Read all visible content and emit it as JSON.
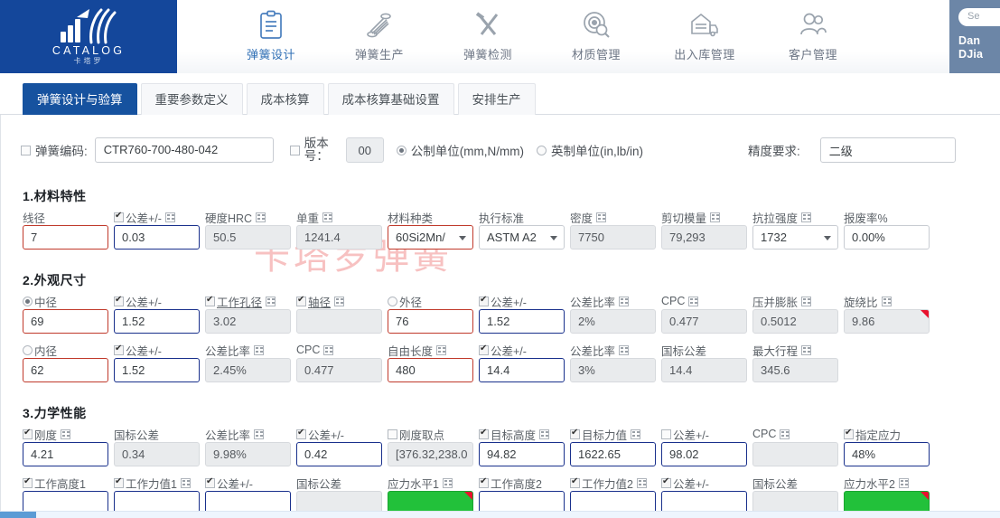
{
  "brand": {
    "name": "CATALOG",
    "sub": "卡塔罗"
  },
  "topnav": [
    {
      "label": "弹簧设计",
      "icon": "clipboard-icon",
      "active": true
    },
    {
      "label": "弹簧生产",
      "icon": "spring-icon",
      "active": false
    },
    {
      "label": "弹簧检测",
      "icon": "tools-icon",
      "active": false
    },
    {
      "label": "材质管理",
      "icon": "target-search-icon",
      "active": false
    },
    {
      "label": "出入库管理",
      "icon": "warehouse-truck-icon",
      "active": false
    },
    {
      "label": "客户管理",
      "icon": "users-icon",
      "active": false
    }
  ],
  "user": {
    "search_placeholder": "Se",
    "name_line1": "Dan",
    "name_line2": "DJia"
  },
  "tabs": [
    {
      "label": "弹簧设计与验算",
      "active": true
    },
    {
      "label": "重要参数定义",
      "active": false
    },
    {
      "label": "成本核算",
      "active": false
    },
    {
      "label": "成本核算基础设置",
      "active": false
    },
    {
      "label": "安排生产",
      "active": false
    }
  ],
  "watermark": "卡塔罗弹簧",
  "header": {
    "code_label": "弹簧编码:",
    "code_value": "CTR760-700-480-042",
    "version_label": "版本号：",
    "version_value": "00",
    "unit_metric": "公制单位(mm,N/mm)",
    "unit_imperial": "英制单位(in,lb/in)",
    "precision_label": "精度要求:",
    "precision_value": "二级"
  },
  "sections": [
    {
      "title": "1.材料特性",
      "rows": [
        [
          {
            "label": "线径",
            "value": "7",
            "style": "red",
            "check": "none"
          },
          {
            "label": "公差+/-",
            "value": "0.03",
            "style": "blue",
            "check": "checked",
            "calc": true
          },
          {
            "label": "硬度HRC",
            "value": "50.5",
            "style": "ro",
            "check": "none",
            "calc": true
          },
          {
            "label": "单重",
            "value": "1241.4",
            "style": "ro",
            "check": "none",
            "calc": true
          },
          {
            "label": "材料种类",
            "value": "60Si2Mn/",
            "style": "red",
            "check": "none",
            "select": true
          },
          {
            "label": "执行标准",
            "value": "ASTM A2",
            "style": "plain",
            "check": "none",
            "select": true
          },
          {
            "label": "密度",
            "value": "7750",
            "style": "ro",
            "check": "none",
            "calc": true
          },
          {
            "label": "剪切模量",
            "value": "79,293",
            "style": "ro",
            "check": "none",
            "calc": true
          },
          {
            "label": "抗拉强度",
            "value": "1732",
            "style": "plain",
            "check": "none",
            "calc": true,
            "select": true
          },
          {
            "label": "报废率%",
            "value": "0.00%",
            "style": "plain",
            "check": "none"
          }
        ]
      ]
    },
    {
      "title": "2.外观尺寸",
      "rows": [
        [
          {
            "label": "中径",
            "value": "69",
            "style": "red",
            "check": "radio-sel"
          },
          {
            "label": "公差+/-",
            "value": "1.52",
            "style": "blue",
            "check": "checked"
          },
          {
            "label": "工作孔径",
            "value": "3.02",
            "style": "ro",
            "check": "checked",
            "calc": true,
            "underline": true
          },
          {
            "label": "轴径",
            "value": "",
            "style": "ro",
            "check": "checked",
            "calc": true,
            "underline": true
          },
          {
            "label": "外径",
            "value": "76",
            "style": "red",
            "check": "radio"
          },
          {
            "label": "公差+/-",
            "value": "1.52",
            "style": "blue",
            "check": "checked"
          },
          {
            "label": "公差比率",
            "value": "2%",
            "style": "ro",
            "check": "none",
            "calc": true
          },
          {
            "label": "CPC",
            "value": "0.477",
            "style": "ro",
            "check": "none",
            "calc": true
          },
          {
            "label": "压并膨胀",
            "value": "0.5012",
            "style": "ro",
            "check": "none",
            "calc": true
          },
          {
            "label": "旋绕比",
            "value": "9.86",
            "style": "ro",
            "check": "none",
            "calc": true,
            "corner": true
          }
        ],
        [
          {
            "label": "内径",
            "value": "62",
            "style": "red",
            "check": "radio"
          },
          {
            "label": "公差+/-",
            "value": "1.52",
            "style": "blue",
            "check": "checked"
          },
          {
            "label": "公差比率",
            "value": "2.45%",
            "style": "ro",
            "check": "none",
            "calc": true
          },
          {
            "label": "CPC",
            "value": "0.477",
            "style": "ro",
            "check": "none",
            "calc": true
          },
          {
            "label": "自由长度",
            "value": "480",
            "style": "red",
            "check": "none",
            "calc": true
          },
          {
            "label": "公差+/-",
            "value": "14.4",
            "style": "blue",
            "check": "checked"
          },
          {
            "label": "公差比率",
            "value": "3%",
            "style": "ro",
            "check": "none",
            "calc": true
          },
          {
            "label": "国标公差",
            "value": "14.4",
            "style": "ro",
            "check": "none"
          },
          {
            "label": "最大行程",
            "value": "345.6",
            "style": "ro",
            "check": "none",
            "calc": true
          }
        ]
      ]
    },
    {
      "title": "3.力学性能",
      "rows": [
        [
          {
            "label": "刚度",
            "value": "4.21",
            "style": "blue",
            "check": "checked",
            "calc": true
          },
          {
            "label": "国标公差",
            "value": "0.34",
            "style": "ro",
            "check": "none"
          },
          {
            "label": "公差比率",
            "value": "9.98%",
            "style": "ro",
            "check": "none",
            "calc": true
          },
          {
            "label": "公差+/-",
            "value": "0.42",
            "style": "blue",
            "check": "checked"
          },
          {
            "label": "刚度取点",
            "value": "[376.32,238.0",
            "style": "ro",
            "check": "unchecked"
          },
          {
            "label": "目标高度",
            "value": "94.82",
            "style": "blue",
            "check": "checked",
            "calc": true
          },
          {
            "label": "目标力值",
            "value": "1622.65",
            "style": "blue",
            "check": "checked",
            "calc": true
          },
          {
            "label": "公差+/-",
            "value": "98.02",
            "style": "blue",
            "check": "unchecked"
          },
          {
            "label": "CPC",
            "value": "",
            "style": "ro",
            "check": "none",
            "calc": true
          },
          {
            "label": "指定应力",
            "value": "48%",
            "style": "blue",
            "check": "checked"
          }
        ],
        [
          {
            "label": "工作高度1",
            "value": "",
            "style": "blue",
            "check": "checked"
          },
          {
            "label": "工作力值1",
            "value": "",
            "style": "blue",
            "check": "checked",
            "calc": true
          },
          {
            "label": "公差+/-",
            "value": "",
            "style": "blue",
            "check": "checked"
          },
          {
            "label": "国标公差",
            "value": "",
            "style": "ro",
            "check": "none"
          },
          {
            "label": "应力水平1",
            "value": "",
            "style": "green",
            "check": "none",
            "calc": true,
            "corner": true
          },
          {
            "label": "工作高度2",
            "value": "",
            "style": "blue",
            "check": "checked"
          },
          {
            "label": "工作力值2",
            "value": "",
            "style": "blue",
            "check": "checked",
            "calc": true
          },
          {
            "label": "公差+/-",
            "value": "",
            "style": "blue",
            "check": "checked"
          },
          {
            "label": "国标公差",
            "value": "",
            "style": "ro",
            "check": "none"
          },
          {
            "label": "应力水平2",
            "value": "",
            "style": "green",
            "check": "none",
            "calc": true,
            "corner": true
          }
        ]
      ]
    }
  ],
  "colors": {
    "brand_blue": "#14479b",
    "tab_active": "#16529f",
    "required_red": "#c0392b",
    "editable_blue": "#19308c",
    "ok_green": "#22c13a",
    "flag_red": "#e8112d",
    "watermark_pink": "#f6b7b7"
  }
}
